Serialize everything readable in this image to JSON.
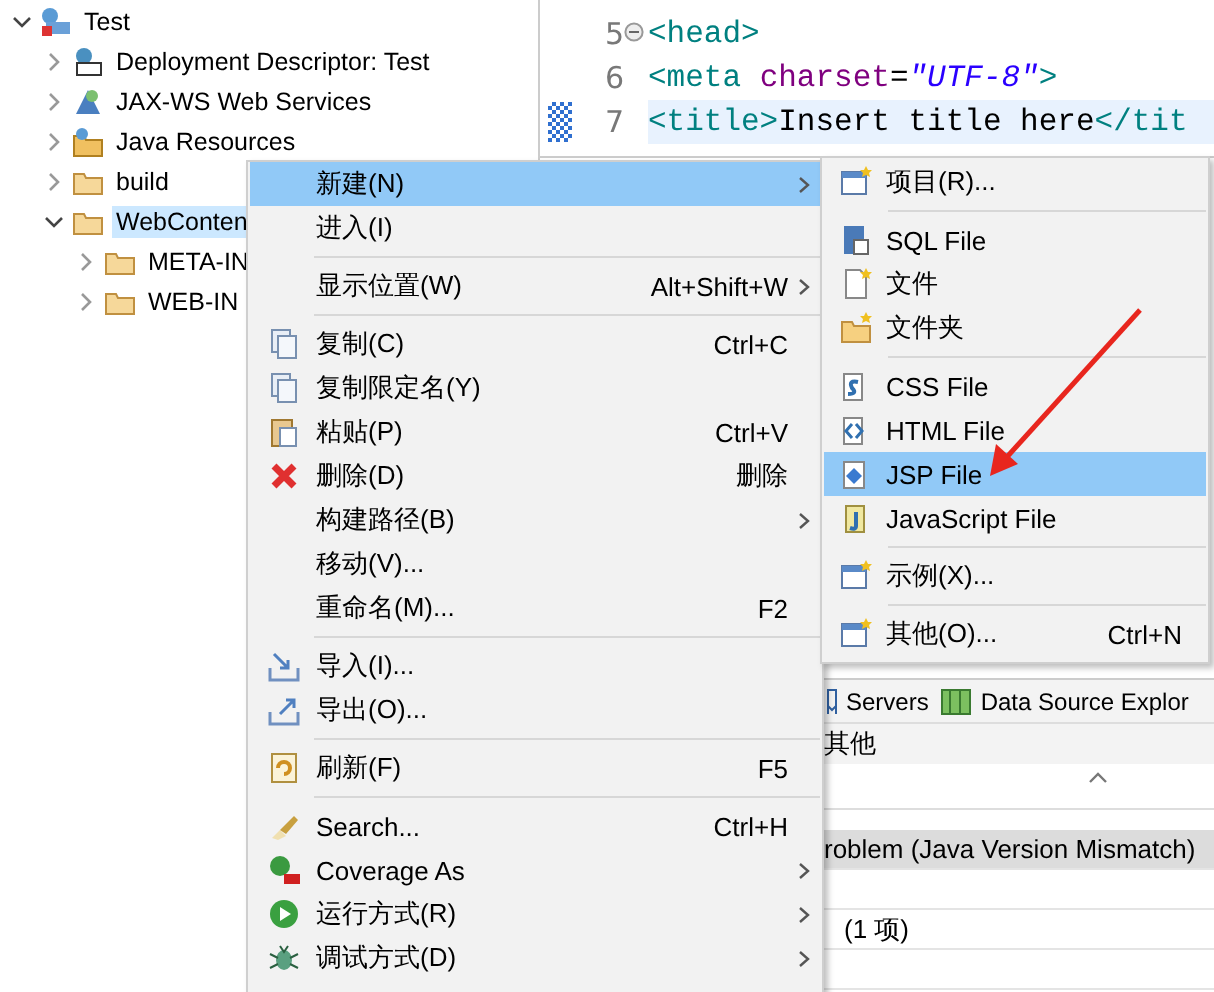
{
  "project_tree": [
    {
      "label": "Test",
      "expanded": true,
      "selected": false,
      "children": [
        {
          "label": "Deployment Descriptor: Test",
          "expanded": false,
          "selected": false
        },
        {
          "label": "JAX-WS Web Services",
          "expanded": false,
          "selected": false
        },
        {
          "label": "Java Resources",
          "expanded": false,
          "selected": false
        },
        {
          "label": "build",
          "expanded": false,
          "selected": false
        },
        {
          "label": "WebConten",
          "expanded": true,
          "selected": true,
          "children": [
            {
              "label": "META-IN",
              "expanded": false,
              "selected": false
            },
            {
              "label": "WEB-IN",
              "expanded": false,
              "selected": false
            }
          ]
        }
      ]
    }
  ],
  "editor": {
    "lines": [
      {
        "number": "5",
        "folded": false,
        "current": false,
        "tokens": [
          {
            "kind": "tag",
            "text": "<head>"
          }
        ]
      },
      {
        "number": "6",
        "current": false,
        "tokens": [
          {
            "kind": "tag",
            "text": "<meta "
          },
          {
            "kind": "attr",
            "text": "charset"
          },
          {
            "kind": "text",
            "text": "="
          },
          {
            "kind": "string",
            "text": "\"UTF-8\""
          },
          {
            "kind": "tag",
            "text": ">"
          }
        ]
      },
      {
        "number": "7",
        "current": true,
        "tokens": [
          {
            "kind": "tag",
            "text": "<title>"
          },
          {
            "kind": "text",
            "text": "Insert title here"
          },
          {
            "kind": "tag",
            "text": "</tit"
          }
        ]
      }
    ]
  },
  "bottom_panel": {
    "tabs": [
      {
        "label": "Servers"
      },
      {
        "label": "Data Source Explor"
      }
    ],
    "section": "其他",
    "rows": [
      {
        "text": "roblem (Java Version Mismatch)",
        "selected": true
      },
      {
        "text": "(1 项)",
        "selected": false
      }
    ]
  },
  "context_menu": {
    "items": [
      {
        "kind": "item",
        "label": "新建(N)",
        "submenu": true,
        "selected": true
      },
      {
        "kind": "item",
        "label": "进入(I)",
        "submenu": false,
        "selected": false
      },
      {
        "kind": "separator"
      },
      {
        "kind": "item",
        "label": "显示位置(W)",
        "shortcut": "Alt+Shift+W",
        "submenu": true,
        "selected": false
      },
      {
        "kind": "separator"
      },
      {
        "kind": "item",
        "label": "复制(C)",
        "shortcut": "Ctrl+C",
        "submenu": false,
        "selected": false
      },
      {
        "kind": "item",
        "label": "复制限定名(Y)",
        "submenu": false,
        "selected": false
      },
      {
        "kind": "item",
        "label": "粘贴(P)",
        "shortcut": "Ctrl+V",
        "submenu": false,
        "selected": false
      },
      {
        "kind": "item",
        "label": "删除(D)",
        "shortcut": "删除",
        "submenu": false,
        "selected": false
      },
      {
        "kind": "item",
        "label": "构建路径(B)",
        "submenu": true,
        "selected": false
      },
      {
        "kind": "item",
        "label": "移动(V)...",
        "submenu": false,
        "selected": false
      },
      {
        "kind": "item",
        "label": "重命名(M)...",
        "shortcut": "F2",
        "submenu": false,
        "selected": false
      },
      {
        "kind": "separator"
      },
      {
        "kind": "item",
        "label": "导入(I)...",
        "submenu": false,
        "selected": false
      },
      {
        "kind": "item",
        "label": "导出(O)...",
        "submenu": false,
        "selected": false
      },
      {
        "kind": "separator"
      },
      {
        "kind": "item",
        "label": "刷新(F)",
        "shortcut": "F5",
        "submenu": false,
        "selected": false
      },
      {
        "kind": "separator"
      },
      {
        "kind": "item",
        "label": "Search...",
        "shortcut": "Ctrl+H",
        "submenu": false,
        "selected": false
      },
      {
        "kind": "item",
        "label": "Coverage As",
        "submenu": true,
        "selected": false
      },
      {
        "kind": "item",
        "label": "运行方式(R)",
        "submenu": true,
        "selected": false
      },
      {
        "kind": "item",
        "label": "调试方式(D)",
        "submenu": true,
        "selected": false
      }
    ]
  },
  "submenu": {
    "items": [
      {
        "kind": "item",
        "label": "项目(R)...",
        "selected": false
      },
      {
        "kind": "separator"
      },
      {
        "kind": "item",
        "label": "SQL File",
        "selected": false
      },
      {
        "kind": "item",
        "label": "文件",
        "selected": false
      },
      {
        "kind": "item",
        "label": "文件夹",
        "selected": false
      },
      {
        "kind": "separator"
      },
      {
        "kind": "item",
        "label": "CSS File",
        "selected": false
      },
      {
        "kind": "item",
        "label": "HTML File",
        "selected": false
      },
      {
        "kind": "item",
        "label": "JSP File",
        "selected": true
      },
      {
        "kind": "item",
        "label": "JavaScript File",
        "selected": false
      },
      {
        "kind": "separator"
      },
      {
        "kind": "item",
        "label": "示例(X)...",
        "selected": false
      },
      {
        "kind": "separator"
      },
      {
        "kind": "item",
        "label": "其他(O)...",
        "shortcut": "Ctrl+N",
        "selected": false
      }
    ]
  }
}
